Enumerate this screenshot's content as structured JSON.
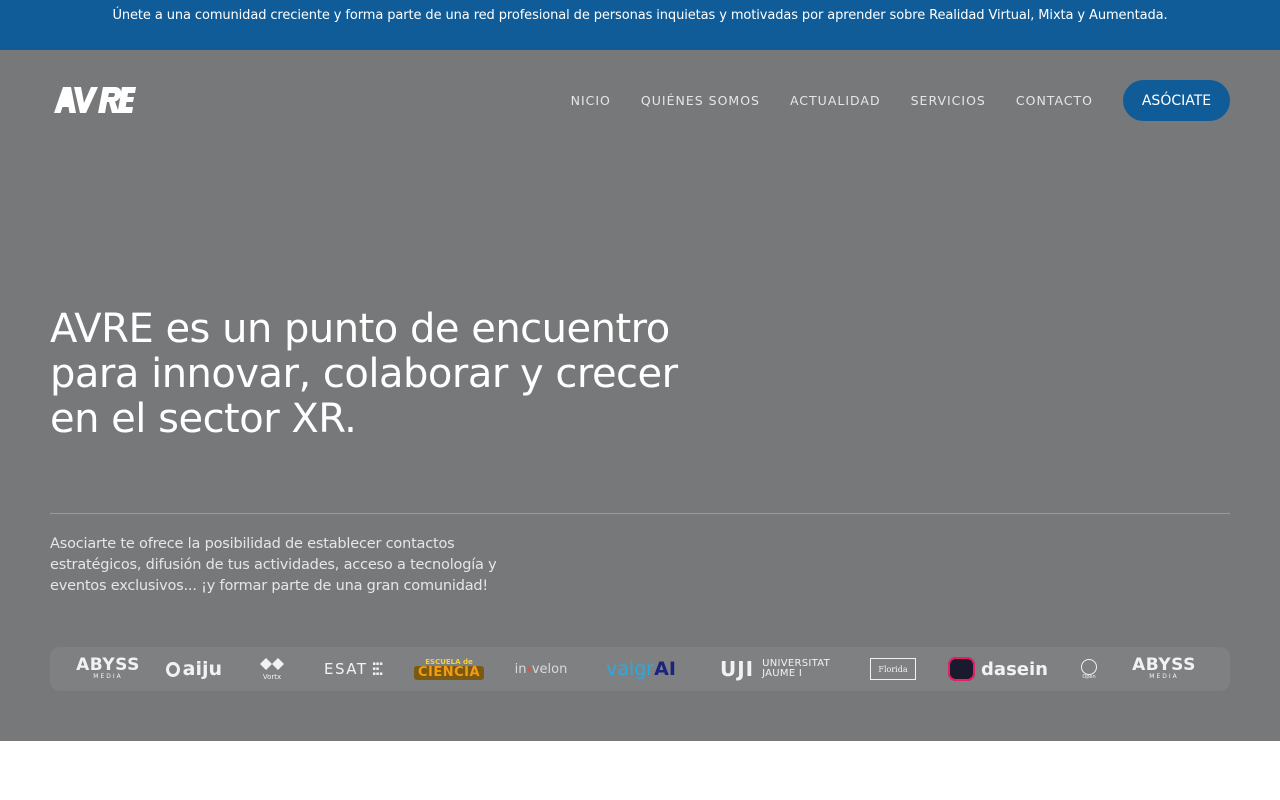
{
  "topbar": {
    "text": "Únete a una comunidad creciente y forma parte de una red profesional de personas inquietas y motivadas por aprender sobre Realidad Virtual, Mixta y Aumentada."
  },
  "header": {
    "logo_text": "AVRE",
    "nav": [
      {
        "label": "NICIO"
      },
      {
        "label": "QUIÉNES SOMOS"
      },
      {
        "label": "ACTUALIDAD"
      },
      {
        "label": "SERVICIOS"
      },
      {
        "label": "CONTACTO"
      }
    ],
    "cta_label": "ASÓCIATE"
  },
  "hero": {
    "headline": "AVRE es un punto de encuentro para innovar, colaborar y crecer en el sector XR.",
    "subtext": "Asociarte te ofrece la posibilidad de establecer contactos estratégicos, difusión de tus actividades, acceso a tecnología y eventos exclusivos... ¡y formar parte de una gran comunidad!"
  },
  "partners": {
    "abyss": {
      "name": "ABYSS",
      "sub": "MEDIA"
    },
    "aiju": {
      "name": "aiju"
    },
    "vortx": {
      "name": "Vortx"
    },
    "esat": {
      "name": "ESAT"
    },
    "ciencia": {
      "top": "ESCUELA de",
      "bottom": "CIENCIA"
    },
    "invelon": {
      "pre": "in",
      "mid": "›",
      "post": "velon"
    },
    "valgrai": {
      "pre": "valgr",
      "post": "AI"
    },
    "uji": {
      "name": "UJI",
      "uni_line1": "UNIVERSITAT",
      "uni_line2": "JAUME I"
    },
    "florida": {
      "name": "Florida"
    },
    "dasein": {
      "name": "dasein"
    },
    "open": {
      "name": "Open"
    },
    "abyss2": {
      "name": "ABYSS",
      "sub": "MEDIA"
    }
  },
  "colors": {
    "brand_blue": "#0f5c99",
    "hero_gray": "#77787a"
  }
}
